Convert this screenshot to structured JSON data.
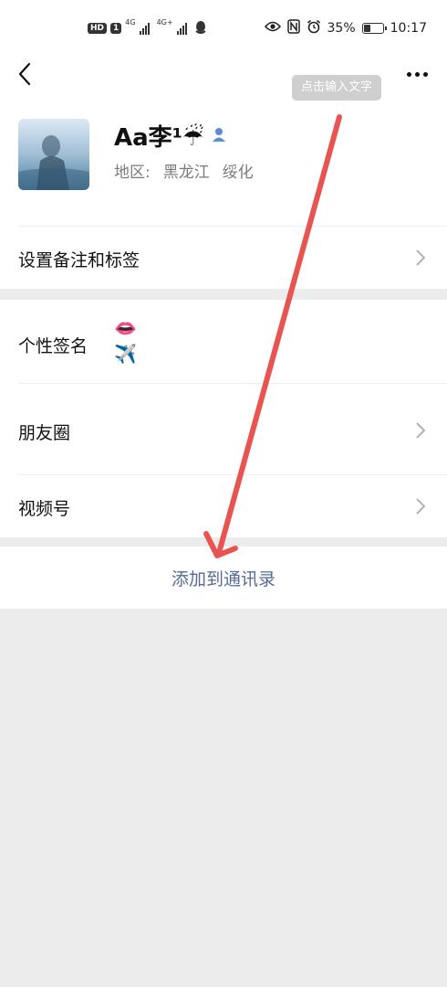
{
  "status_bar": {
    "left_badges": [
      "HD",
      "1"
    ],
    "network_a": "4G",
    "network_b": "4G+",
    "battery_percent": "35%",
    "battery_level": 0.35,
    "time": "10:17",
    "icons": [
      "eye-icon",
      "nfc-icon",
      "alarm-icon",
      "battery-icon",
      "qq-icon"
    ]
  },
  "header": {
    "tooltip": "点击输入文字",
    "nickname": "Aa李¹☔",
    "region_label": "地区:",
    "region_province": "黑龙江",
    "region_city": "绥化"
  },
  "rows": {
    "remark": {
      "label": "设置备注和标签"
    },
    "signature": {
      "label": "个性签名",
      "emojis": [
        "👄",
        "✈️"
      ]
    },
    "moments": {
      "label": "朋友圈"
    },
    "channels": {
      "label": "视频号"
    }
  },
  "actions": {
    "add_contact": "添加到通讯录"
  },
  "colors": {
    "link_blue": "#576b95",
    "annotation_red": "#e85450",
    "background": "#ececec"
  }
}
